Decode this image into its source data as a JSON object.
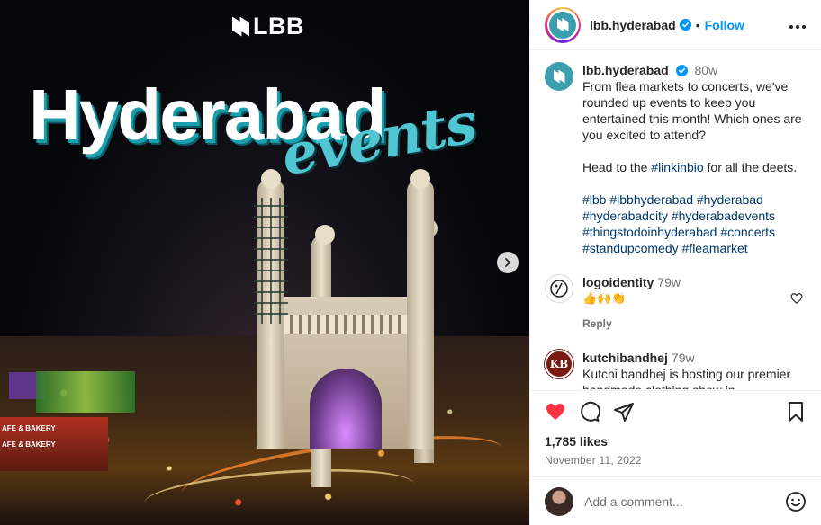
{
  "media": {
    "brand": "LBB",
    "headline": "Hyderabad",
    "headline_script": "events",
    "shop_sign_1": "AFE & BAKERY",
    "shop_sign_2": "AFE & BAKERY",
    "next_icon": "chevron-right-icon"
  },
  "header": {
    "username": "lbb.hyderabad",
    "verified": true,
    "separator": "•",
    "follow_label": "Follow",
    "more_icon": "more-horizontal-icon"
  },
  "caption": {
    "username": "lbb.hyderabad",
    "age": "80w",
    "text": "From flea markets to concerts, we've rounded up events to keep you entertained this month! Which ones are you excited to attend?",
    "line2_prefix": "Head to the ",
    "line2_tag": "#linkinbio",
    "line2_suffix": " for all the deets.",
    "hashtags": "#lbb #lbbhyderabad #hyderabad #hyderabadcity #hyderabadevents #thingstodoinhyderabad #concerts #standupcomedy #fleamarket"
  },
  "comments": [
    {
      "username": "logoidentity",
      "age": "79w",
      "text": "👍🙌👏",
      "reply_label": "Reply"
    },
    {
      "username": "kutchibandhej",
      "age": "79w",
      "avatar_text": "KB",
      "text": "Kutchi bandhej is hosting our premier handmade clothing show in"
    }
  ],
  "actions": {
    "likes": "1,785 likes",
    "date": "November 11, 2022",
    "liked": true,
    "accent_color": "#ff3040"
  },
  "add_comment": {
    "placeholder": "Add a comment..."
  },
  "colors": {
    "link_blue": "#0095f6",
    "hashtag": "#00376b",
    "muted": "#737373"
  }
}
